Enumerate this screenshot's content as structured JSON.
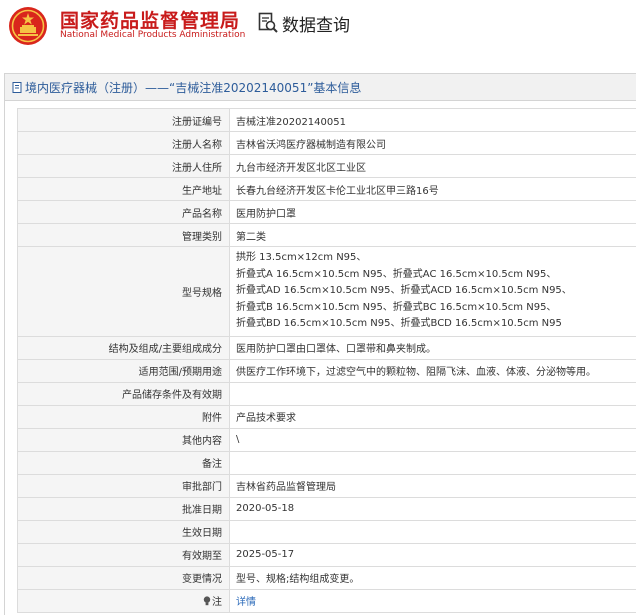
{
  "header": {
    "agency_cn": "国家药品监督管理局",
    "agency_en": "National Medical Products Administration",
    "query_label": "数据查询",
    "brand_color": "#c81b1b"
  },
  "panel": {
    "title": "境内医疗器械（注册）——“吉械注准20202140051”基本信息"
  },
  "rows": {
    "reg_no": {
      "label": "注册证编号",
      "value": "吉械注准20202140051"
    },
    "registrant": {
      "label": "注册人名称",
      "value": "吉林省沃鸿医疗器械制造有限公司"
    },
    "address": {
      "label": "注册人住所",
      "value": "九台市经济开发区北区工业区"
    },
    "production": {
      "label": "生产地址",
      "value": "长春九台经济开发区卡伦工业北区甲三路16号"
    },
    "product_name": {
      "label": "产品名称",
      "value": "医用防护口罩"
    },
    "category": {
      "label": "管理类别",
      "value": "第二类"
    },
    "models": {
      "label": "型号规格",
      "lines": [
        "拱形 13.5cm×12cm N95、",
        "折叠式A 16.5cm×10.5cm N95、折叠式AC 16.5cm×10.5cm N95、",
        "折叠式AD 16.5cm×10.5cm N95、折叠式ACD 16.5cm×10.5cm N95、",
        "折叠式B 16.5cm×10.5cm N95、折叠式BC 16.5cm×10.5cm N95、",
        "折叠式BD 16.5cm×10.5cm N95、折叠式BCD 16.5cm×10.5cm N95"
      ]
    },
    "structure": {
      "label": "结构及组成/主要组成成分",
      "value": "医用防护口罩由口罩体、口罩带和鼻夹制成。"
    },
    "scope": {
      "label": "适用范围/预期用途",
      "value": "供医疗工作环境下，过滤空气中的颗粒物、阻隔飞沫、血液、体液、分泌物等用。"
    },
    "storage": {
      "label": "产品储存条件及有效期",
      "value": ""
    },
    "attachment": {
      "label": "附件",
      "value": "产品技术要求"
    },
    "other": {
      "label": "其他内容",
      "value": "\\"
    },
    "remark": {
      "label": "备注",
      "value": ""
    },
    "approver": {
      "label": "审批部门",
      "value": "吉林省药品监督管理局"
    },
    "approved": {
      "label": "批准日期",
      "value": "2020-05-18"
    },
    "effective": {
      "label": "生效日期",
      "value": ""
    },
    "expiry": {
      "label": "有效期至",
      "value": "2025-05-17"
    },
    "changes": {
      "label": "变更情况",
      "value": "型号、规格;结构组成变更。"
    },
    "note": {
      "label": "注",
      "value": "详情"
    }
  }
}
